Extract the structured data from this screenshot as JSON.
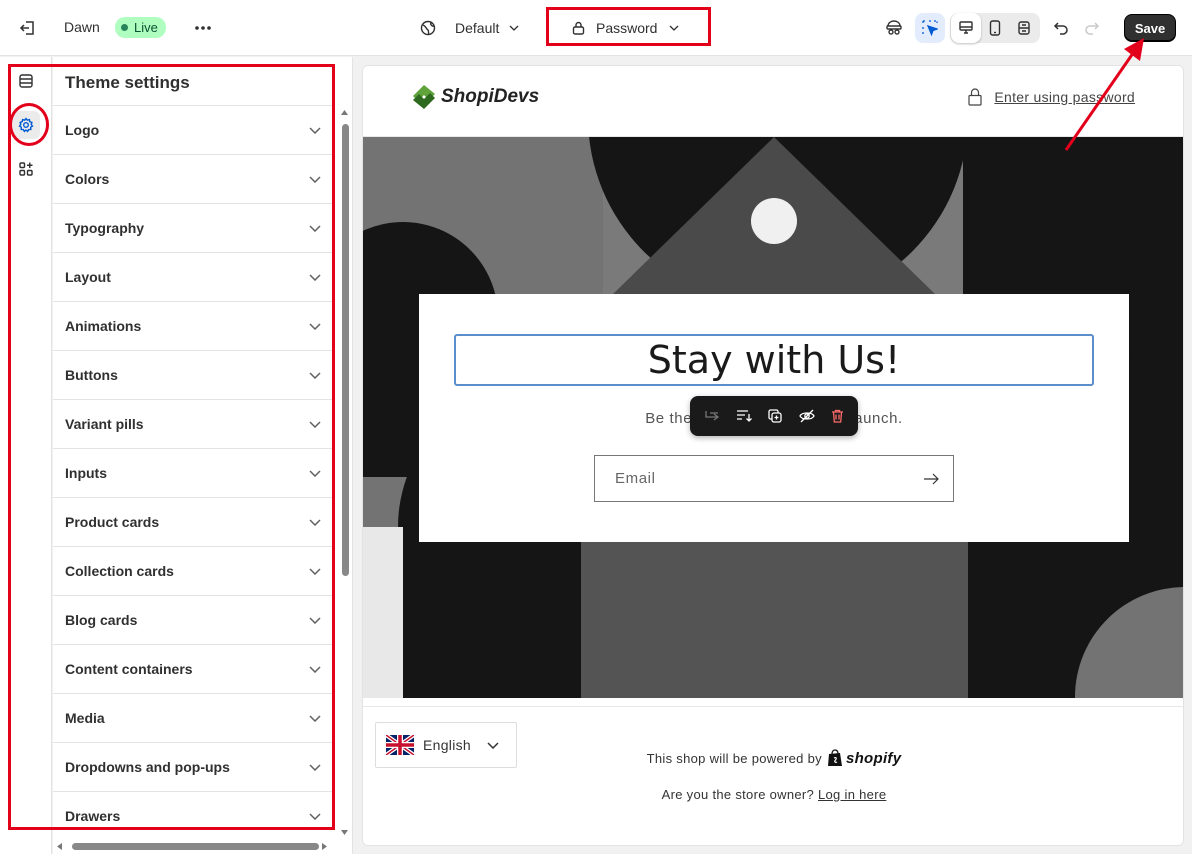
{
  "topbar": {
    "exit_icon": "exit-icon",
    "theme_name": "Dawn",
    "live_badge": "Live",
    "more_icon": "ellipsis-icon",
    "template_selector": "Default",
    "page_selector": "Password",
    "save_label": "Save",
    "colors": {
      "accent": "#303030",
      "live_bg": "#affebf",
      "inspector_active": "#005bd3"
    }
  },
  "rail": {
    "items": [
      {
        "name": "sections",
        "icon": "sections-icon"
      },
      {
        "name": "theme-settings",
        "icon": "gear-icon",
        "active": true
      },
      {
        "name": "apps",
        "icon": "apps-icon"
      }
    ]
  },
  "panel": {
    "title": "Theme settings",
    "settings": [
      "Logo",
      "Colors",
      "Typography",
      "Layout",
      "Animations",
      "Buttons",
      "Variant pills",
      "Inputs",
      "Product cards",
      "Collection cards",
      "Blog cards",
      "Content containers",
      "Media",
      "Dropdowns and pop-ups",
      "Drawers"
    ]
  },
  "preview": {
    "logo_text": "ShopiDevs",
    "enter_password": "Enter using password",
    "heading": "Stay with Us!",
    "subtext_left": "Be the",
    "subtext_right": "aunch.",
    "email_placeholder": "Email",
    "language": "English",
    "powered_by": "This shop will be powered by",
    "shopify_brand": "shopify",
    "owner_question": "Are you the store owner?",
    "owner_link": "Log in here"
  },
  "annotations": {
    "highlight_color": "#e3001b"
  }
}
